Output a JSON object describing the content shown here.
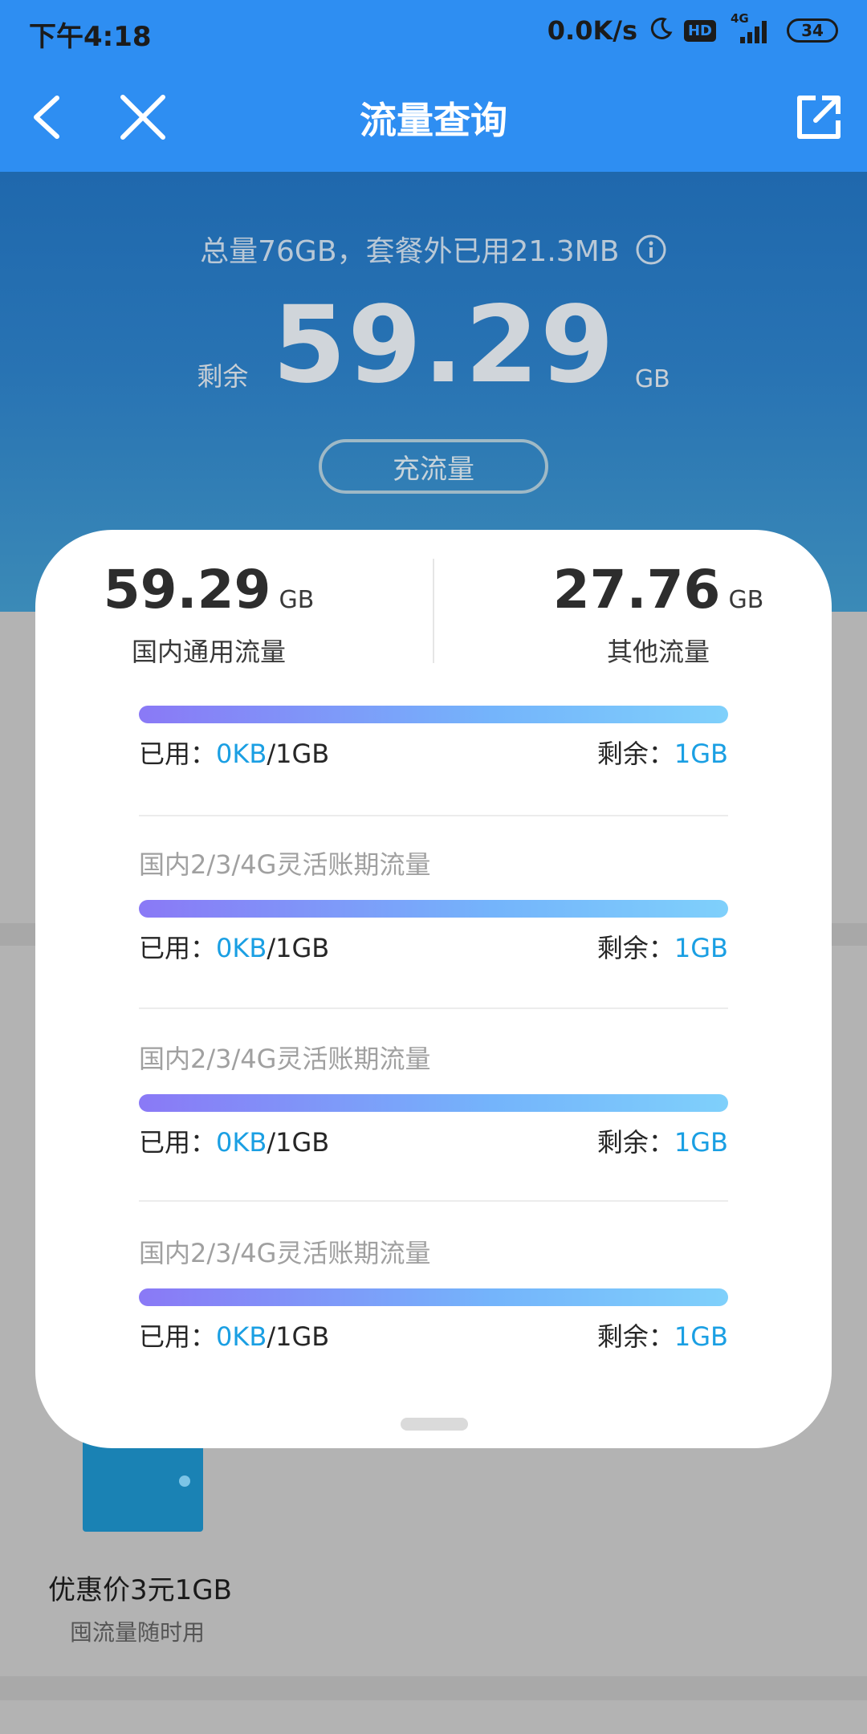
{
  "status_bar": {
    "time": "下午4:18",
    "speed": "0.0K/s",
    "hd": "HD",
    "network": "4G",
    "battery": "34"
  },
  "nav": {
    "title": "流量查询",
    "back_icon": "chevron-left-icon",
    "close_icon": "close-icon",
    "share_icon": "share-external-icon"
  },
  "header": {
    "summary": "总量76GB，套餐外已用21.3MB",
    "remain_label": "剩余",
    "remain_value": "59.29",
    "remain_unit": "GB",
    "recharge_label": "充流量"
  },
  "card": {
    "domestic": {
      "value": "59.29",
      "unit": "GB",
      "label": "国内通用流量"
    },
    "other": {
      "value": "27.76",
      "unit": "GB",
      "label": "其他流量"
    },
    "items": [
      {
        "name": "",
        "used_label": "已用：",
        "used_value": "0KB",
        "total": "/1GB",
        "remain_label": "剩余：",
        "remain_value": "1GB",
        "used_fraction": 0
      },
      {
        "name": "国内2/3/4G灵活账期流量",
        "used_label": "已用：",
        "used_value": "0KB",
        "total": "/1GB",
        "remain_label": "剩余：",
        "remain_value": "1GB",
        "used_fraction": 0
      },
      {
        "name": "国内2/3/4G灵活账期流量",
        "used_label": "已用：",
        "used_value": "0KB",
        "total": "/1GB",
        "remain_label": "剩余：",
        "remain_value": "1GB",
        "used_fraction": 0
      },
      {
        "name": "国内2/3/4G灵活账期流量",
        "used_label": "已用：",
        "used_value": "0KB",
        "total": "/1GB",
        "remain_label": "剩余：",
        "remain_value": "1GB",
        "used_fraction": 0
      }
    ]
  },
  "background": {
    "product_title": "优惠价3元1GB",
    "product_subtitle": "囤流量随时用"
  },
  "colors": {
    "primary_blue": "#2e8ef2",
    "highlight": "#1a9fe3",
    "bar_start": "#8a79f6",
    "bar_end": "#7fd0fb"
  }
}
